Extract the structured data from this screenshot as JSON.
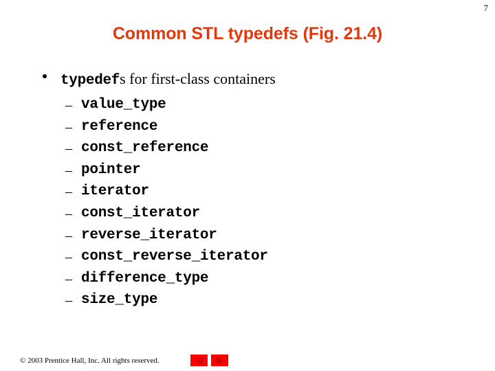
{
  "slide": {
    "page_number": "7",
    "title": "Common STL typedefs (Fig. 21.4)",
    "bullet": {
      "keyword": "typedef",
      "rest": "s for first-class containers"
    },
    "sub_dash": "–",
    "typedefs": [
      "value_type",
      "reference",
      "const_reference",
      "pointer",
      "iterator",
      "const_iterator",
      "reverse_iterator",
      "const_reverse_iterator",
      "difference_type",
      "size_type"
    ],
    "footer": {
      "copyright": "© 2003 Prentice Hall, Inc. All rights reserved.",
      "prev_label": "",
      "next_label": ""
    },
    "colors": {
      "title": "#E3380D",
      "nav_button_bg": "#FF0000",
      "nav_button_arrow": "#CC0000",
      "text": "#000000",
      "background": "#FFFFFF"
    }
  }
}
